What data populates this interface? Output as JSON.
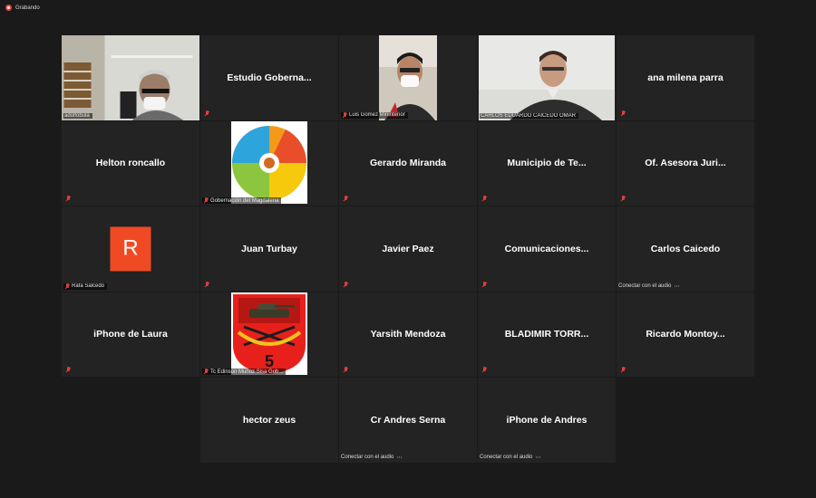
{
  "recording": {
    "label": "Grabando"
  },
  "participants": [
    {
      "kind": "video-office",
      "caption": "adolfobula",
      "active": true
    },
    {
      "kind": "name",
      "name": "Estudio  Goberna...",
      "muted": true
    },
    {
      "kind": "video-man-mask",
      "caption": "Luis Gomez Mininterior",
      "muted": true
    },
    {
      "kind": "video-man-office",
      "caption": "CARLOS EDUARDO CAICEDO OMAR"
    },
    {
      "kind": "name",
      "name": "ana milena parra",
      "muted": true
    },
    {
      "kind": "name",
      "name": "Helton roncallo",
      "muted": true
    },
    {
      "kind": "image-wheel",
      "caption": "Gobernación del Magdalena",
      "muted": true
    },
    {
      "kind": "name",
      "name": "Gerardo Miranda",
      "muted": true
    },
    {
      "kind": "name",
      "name": "Municipio de Te...",
      "muted": true
    },
    {
      "kind": "name",
      "name": "Of. Asesora Juri...",
      "muted": true
    },
    {
      "kind": "avatar",
      "letter": "R",
      "caption": "Rafa Salcedo",
      "muted": true
    },
    {
      "kind": "name",
      "name": "Juan Turbay",
      "muted": true
    },
    {
      "kind": "name",
      "name": "Javier Paez",
      "muted": true
    },
    {
      "kind": "name",
      "name": "Comunicaciones...",
      "muted": true
    },
    {
      "kind": "name",
      "name": "Carlos Caicedo",
      "audio": "Conectar con el audio"
    },
    {
      "kind": "name",
      "name": "iPhone de Laura",
      "muted": true
    },
    {
      "kind": "image-shield",
      "caption": "Tc Edinson Muñoz Sisa Gob...",
      "shield_number": "5",
      "muted": true
    },
    {
      "kind": "name",
      "name": "Yarsith Mendoza",
      "muted": true
    },
    {
      "kind": "name",
      "name": "BLADIMIR  TORR...",
      "muted": true
    },
    {
      "kind": "name",
      "name": "Ricardo  Montoy...",
      "muted": true
    },
    {
      "kind": "empty"
    },
    {
      "kind": "name",
      "name": "hector zeus"
    },
    {
      "kind": "name",
      "name": "Cr Andres Serna",
      "audio": "Conectar con el audio"
    },
    {
      "kind": "name",
      "name": "iPhone de Andres",
      "audio": "Conectar con el audio"
    }
  ],
  "colors": {
    "background": "#1a1a1a",
    "tile": "#232323",
    "active_border": "#b7da27",
    "muted_icon": "#e03e3e",
    "avatar": "#f04a24",
    "recording": "#e8453c"
  }
}
